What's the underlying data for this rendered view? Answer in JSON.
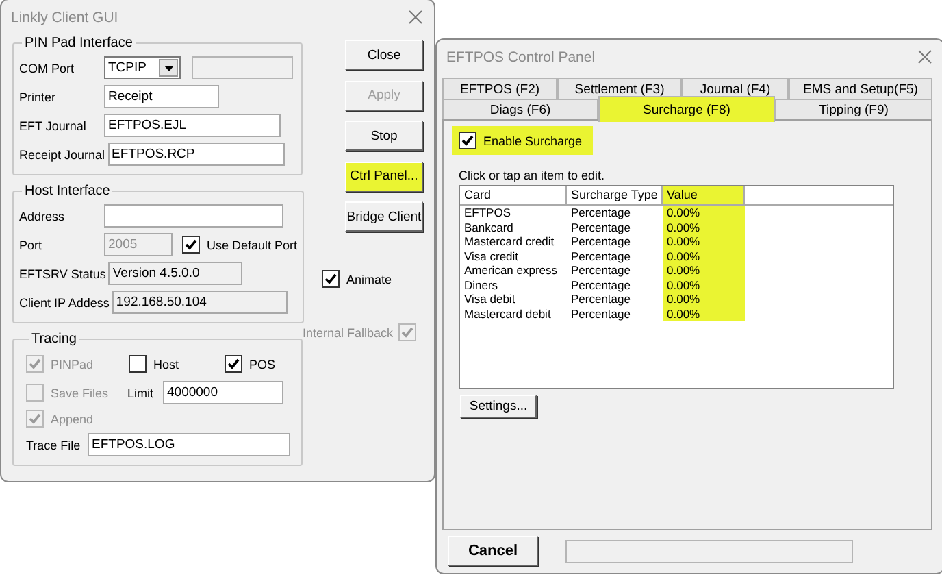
{
  "client_window": {
    "title": "Linkly Client GUI",
    "pin_pad": {
      "legend": "PIN Pad Interface",
      "com_port": {
        "label": "COM Port",
        "value": "TCPIP"
      },
      "printer": {
        "label": "Printer",
        "value": "Receipt"
      },
      "eft_journal": {
        "label": "EFT Journal",
        "value": "EFTPOS.EJL"
      },
      "receipt_journal": {
        "label": "Receipt Journal",
        "value": "EFTPOS.RCP"
      }
    },
    "host": {
      "legend": "Host Interface",
      "address": {
        "label": "Address"
      },
      "port": {
        "label": "Port",
        "value": "2005",
        "disabled": true
      },
      "use_default_port": {
        "label": "Use Default Port",
        "checked": true,
        "disabled": false
      },
      "eftsrv_status": {
        "label": "EFTSRV Status",
        "value": "Version 4.5.0.0"
      },
      "client_ip": {
        "label": "Client IP Addess",
        "value": "192.168.50.104"
      }
    },
    "tracing": {
      "legend": "Tracing",
      "pinpad": {
        "label": "PINPad",
        "checked": true,
        "disabled": true
      },
      "host": {
        "label": "Host",
        "checked": false,
        "disabled": false
      },
      "pos": {
        "label": "POS",
        "checked": true,
        "disabled": false
      },
      "save_files": {
        "label": "Save Files",
        "checked": false,
        "disabled": true
      },
      "limit": {
        "label": "Limit",
        "value": "4000000"
      },
      "append": {
        "label": "Append",
        "checked": true,
        "disabled": true
      },
      "trace_file": {
        "label": "Trace File",
        "value": "EFTPOS.LOG"
      }
    },
    "buttons": [
      {
        "label": "Close",
        "disabled": false,
        "highlighted": false
      },
      {
        "label": "Apply",
        "disabled": true,
        "highlighted": false
      },
      {
        "label": "Stop",
        "disabled": false,
        "highlighted": false
      },
      {
        "label": "Ctrl Panel...",
        "disabled": false,
        "highlighted": true
      },
      {
        "label": "Bridge Client",
        "disabled": false,
        "highlighted": false
      }
    ],
    "animate": {
      "label": "Animate",
      "checked": true,
      "disabled": false
    },
    "internal_fallback": {
      "label": "Internal Fallback",
      "checked": true,
      "disabled": true
    }
  },
  "control_panel": {
    "title": "EFTPOS Control Panel",
    "tab_rows": [
      [
        {
          "label": "EFTPOS (F2)",
          "selected": false,
          "highlighted": false
        },
        {
          "label": "Settlement (F3)",
          "selected": false,
          "highlighted": false
        },
        {
          "label": "Journal (F4)",
          "selected": false,
          "highlighted": false
        },
        {
          "label": "EMS and Setup(F5)",
          "selected": false,
          "highlighted": false
        }
      ],
      [
        {
          "label": "Diags (F6)",
          "selected": false,
          "highlighted": false
        },
        {
          "label": "Surcharge (F8)",
          "selected": true,
          "highlighted": true
        },
        {
          "label": "Tipping (F9)",
          "selected": false,
          "highlighted": false
        }
      ]
    ],
    "enable_surcharge": {
      "label": "Enable Surcharge",
      "checked": true,
      "highlighted": true
    },
    "hint": "Click or tap an item to edit.",
    "table": {
      "columns": [
        {
          "label": "Card",
          "highlighted": false
        },
        {
          "label": "Surcharge Type",
          "highlighted": false
        },
        {
          "label": "Value",
          "highlighted": true
        }
      ],
      "rows": [
        [
          "EFTPOS",
          "Percentage",
          "0.00%"
        ],
        [
          "Bankcard",
          "Percentage",
          "0.00%"
        ],
        [
          "Mastercard credit",
          "Percentage",
          "0.00%"
        ],
        [
          "Visa credit",
          "Percentage",
          "0.00%"
        ],
        [
          "American express",
          "Percentage",
          "0.00%"
        ],
        [
          "Diners",
          "Percentage",
          "0.00%"
        ],
        [
          "Visa debit",
          "Percentage",
          "0.00%"
        ],
        [
          "Mastercard debit",
          "Percentage",
          "0.00%"
        ]
      ]
    },
    "settings_button": "Settings...",
    "cancel_button": "Cancel"
  }
}
